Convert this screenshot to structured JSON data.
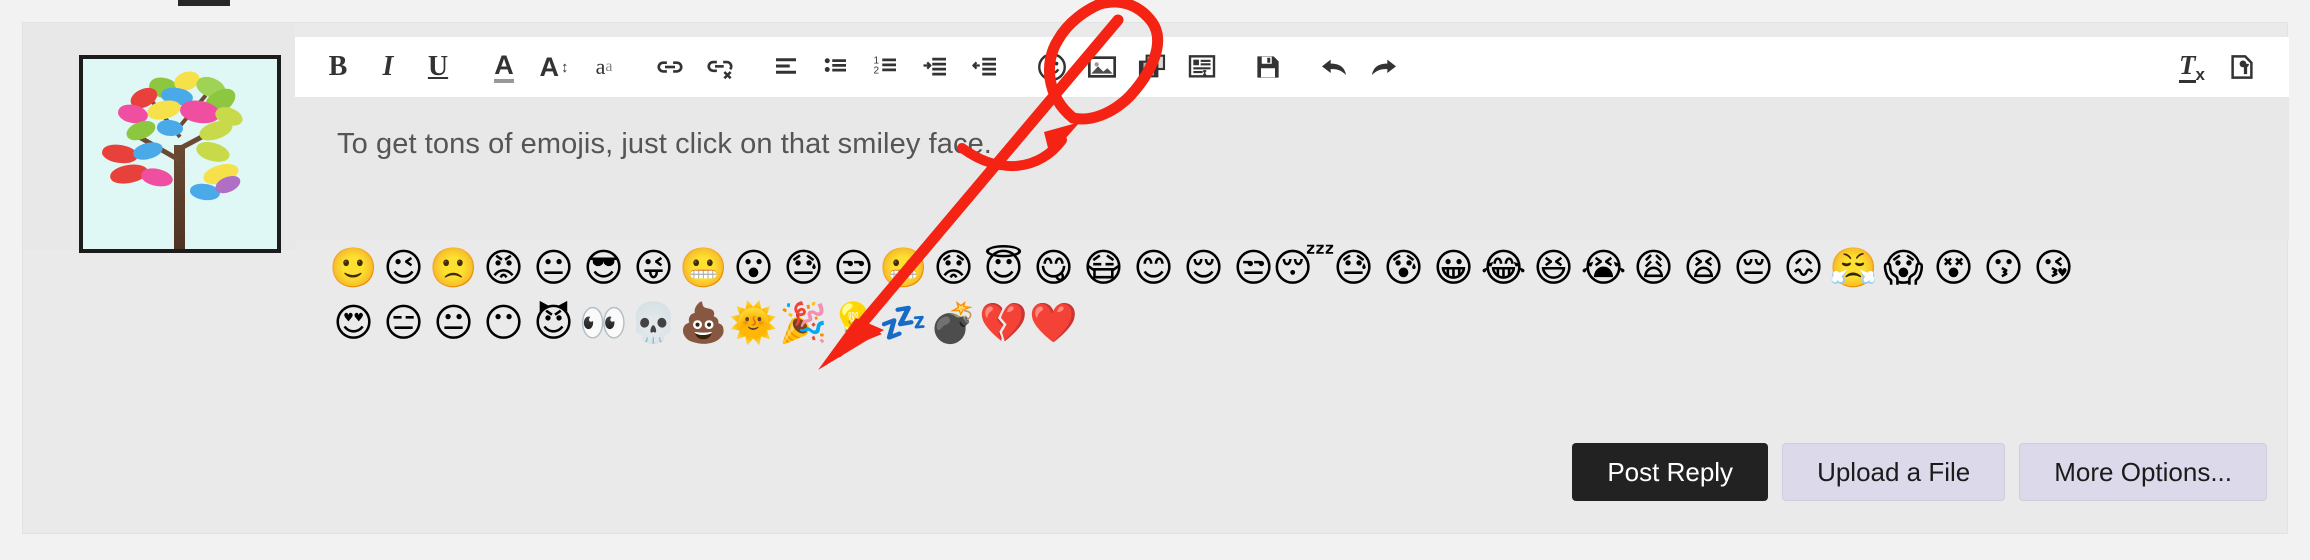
{
  "app": {
    "background_color": "#f2f2f2",
    "panel_color": "#eaeaea"
  },
  "avatar": {
    "name": "user-avatar",
    "description": "colorful tree drawing"
  },
  "toolbar": {
    "items": [
      {
        "icon": "bold-icon",
        "label": "Bold"
      },
      {
        "icon": "italic-icon",
        "label": "Italic"
      },
      {
        "icon": "underline-icon",
        "label": "Underline"
      },
      {
        "icon": "font-color-icon",
        "label": "Font Colour"
      },
      {
        "icon": "font-size-icon",
        "label": "Font Size"
      },
      {
        "icon": "text-case-icon",
        "label": "Text Case"
      },
      {
        "icon": "link-icon",
        "label": "Insert Link"
      },
      {
        "icon": "unlink-icon",
        "label": "Remove Link"
      },
      {
        "icon": "align-icon",
        "label": "Alignment"
      },
      {
        "icon": "bullet-list-icon",
        "label": "Bulleted List"
      },
      {
        "icon": "numbered-list-icon",
        "label": "Numbered List"
      },
      {
        "icon": "indent-icon",
        "label": "Indent"
      },
      {
        "icon": "outdent-icon",
        "label": "Outdent"
      },
      {
        "icon": "smiley-icon",
        "label": "Insert Emoji"
      },
      {
        "icon": "image-icon",
        "label": "Insert Image"
      },
      {
        "icon": "media-icon",
        "label": "Insert Media"
      },
      {
        "icon": "quote-icon",
        "label": "Insert Quote"
      },
      {
        "icon": "save-icon",
        "label": "Save Draft"
      },
      {
        "icon": "undo-icon",
        "label": "Undo"
      },
      {
        "icon": "redo-icon",
        "label": "Redo"
      }
    ],
    "right_items": [
      {
        "icon": "clear-format-icon",
        "label": "Remove Formatting"
      },
      {
        "icon": "source-tools-icon",
        "label": "Source Tools"
      }
    ]
  },
  "editor": {
    "content": "To get tons of emojis, just click on that smiley face."
  },
  "emoji_picker": {
    "row1": [
      {
        "glyph": "🙂",
        "name": "slightly-smiling-face"
      },
      {
        "glyph": "😉",
        "name": "winking-face"
      },
      {
        "glyph": "🙁",
        "name": "slightly-frowning-face"
      },
      {
        "glyph": "😡",
        "name": "pouting-face"
      },
      {
        "glyph": "😐",
        "name": "neutral-face"
      },
      {
        "glyph": "😎",
        "name": "smiling-face-with-sunglasses"
      },
      {
        "glyph": "😜",
        "name": "face-with-tongue-and-winking-eye"
      },
      {
        "glyph": "😬",
        "name": "grimacing-face"
      },
      {
        "glyph": "😮",
        "name": "face-with-open-mouth"
      },
      {
        "glyph": "😓",
        "name": "downcast-face-with-sweat"
      },
      {
        "glyph": "😒",
        "name": "unamused-face"
      },
      {
        "glyph": "😬",
        "name": "grimacing-face-2"
      },
      {
        "glyph": "😟",
        "name": "worried-face"
      },
      {
        "glyph": "😇",
        "name": "smiling-face-with-halo"
      },
      {
        "glyph": "😋",
        "name": "face-savoring-food"
      },
      {
        "glyph": "😷",
        "name": "face-with-medical-mask"
      },
      {
        "glyph": "😊",
        "name": "smiling-face-with-smiling-eyes"
      },
      {
        "glyph": "😌",
        "name": "relieved-face"
      },
      {
        "glyph": "😒",
        "name": "unamused-face-2"
      },
      {
        "glyph": "😴",
        "name": "sleeping-face"
      },
      {
        "glyph": "😓",
        "name": "face-with-cold-sweat"
      },
      {
        "glyph": "😰",
        "name": "anxious-face-with-sweat"
      },
      {
        "glyph": "😀",
        "name": "grinning-face"
      },
      {
        "glyph": "😂",
        "name": "face-with-tears-of-joy"
      },
      {
        "glyph": "😆",
        "name": "grinning-squinting-face"
      },
      {
        "glyph": "😭",
        "name": "loudly-crying-face"
      },
      {
        "glyph": "😩",
        "name": "weary-face"
      },
      {
        "glyph": "😫",
        "name": "tired-face"
      },
      {
        "glyph": "😔",
        "name": "pensive-face"
      },
      {
        "glyph": "😖",
        "name": "confounded-face"
      },
      {
        "glyph": "😤",
        "name": "face-with-steam-from-nose"
      },
      {
        "glyph": "😱",
        "name": "face-screaming-in-fear"
      },
      {
        "glyph": "😵",
        "name": "dizzy-face"
      },
      {
        "glyph": "😗",
        "name": "kissing-face"
      },
      {
        "glyph": "😘",
        "name": "face-blowing-a-kiss"
      }
    ],
    "row2": [
      {
        "glyph": "😍",
        "name": "smiling-face-with-heart-eyes"
      },
      {
        "glyph": "😑",
        "name": "expressionless-face"
      },
      {
        "glyph": "😐",
        "name": "neutral-face-2"
      },
      {
        "glyph": "😶",
        "name": "face-without-mouth"
      },
      {
        "glyph": "😈",
        "name": "smiling-face-with-horns"
      },
      {
        "glyph": "👀",
        "name": "eyes"
      },
      {
        "glyph": "💀",
        "name": "skull"
      },
      {
        "glyph": "💩",
        "name": "pile-of-poo"
      },
      {
        "glyph": "🌞",
        "name": "sun-with-face"
      },
      {
        "glyph": "🎉",
        "name": "party-popper"
      },
      {
        "glyph": "💡",
        "name": "light-bulb"
      },
      {
        "glyph": "💤",
        "name": "zzz"
      },
      {
        "glyph": "💣",
        "name": "bomb"
      },
      {
        "glyph": "💔",
        "name": "broken-heart"
      },
      {
        "glyph": "❤️",
        "name": "red-heart"
      }
    ]
  },
  "actions": {
    "post_reply": "Post Reply",
    "upload_file": "Upload a File",
    "more_options": "More Options..."
  },
  "annotations": {
    "color": "#f42314",
    "circle_target": "smiley-icon",
    "arrow_note": "curved arrow pointing to smiley toolbar button",
    "line_note": "diagonal line from smiley toolbar button down to emoji palette"
  }
}
